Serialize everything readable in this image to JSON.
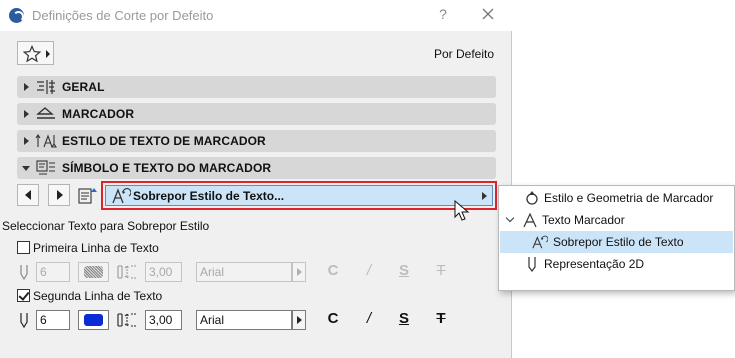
{
  "window": {
    "title": "Definições de Corte por Defeito",
    "help_glyph": "?",
    "close_glyph": "✕"
  },
  "header": {
    "favorites_icon": "star-icon",
    "default_label": "Por Defeito"
  },
  "sections": [
    {
      "label": "GERAL",
      "icon": "general-settings-icon",
      "expanded": false
    },
    {
      "label": "MARCADOR",
      "icon": "marker-icon",
      "expanded": false
    },
    {
      "label": "ESTILO DE TEXTO DE MARCADOR",
      "icon": "marker-text-style-icon",
      "expanded": false
    },
    {
      "label": "SÍMBOLO E TEXTO DO MARCADOR",
      "icon": "marker-symbol-text-icon",
      "expanded": true
    }
  ],
  "panel": {
    "override_dropdown": "Sobrepor Estilo de Texto...",
    "select_text_label": "Seleccionar Texto para Sobrepor Estilo",
    "line1": {
      "label": "Primeira Linha de Texto",
      "checked": false,
      "pen": "6",
      "size": "3,00",
      "font": "Arial",
      "styles": [
        "C",
        "/",
        "S",
        "T"
      ]
    },
    "line2": {
      "label": "Segunda Linha de Texto",
      "checked": true,
      "pen": "6",
      "size": "3,00",
      "font": "Arial",
      "styles": [
        "C",
        "/",
        "S",
        "T"
      ],
      "pen_color": "#0a2bd6"
    }
  },
  "popup": {
    "items": [
      {
        "label": "Estilo e Geometria de Marcador",
        "icon": "marker-geometry-icon",
        "selected": false
      },
      {
        "label": "Texto Marcador",
        "icon": "text-marker-icon",
        "selected": false,
        "expanded": true
      },
      {
        "label": "Sobrepor Estilo de Texto",
        "icon": "override-text-style-icon",
        "selected": true
      },
      {
        "label": "Representação 2D",
        "icon": "2d-representation-icon",
        "selected": false
      }
    ]
  },
  "colors": {
    "highlight": "#cce4f7",
    "red_outline": "#e0232b",
    "pen_blue": "#0a2bd6"
  }
}
